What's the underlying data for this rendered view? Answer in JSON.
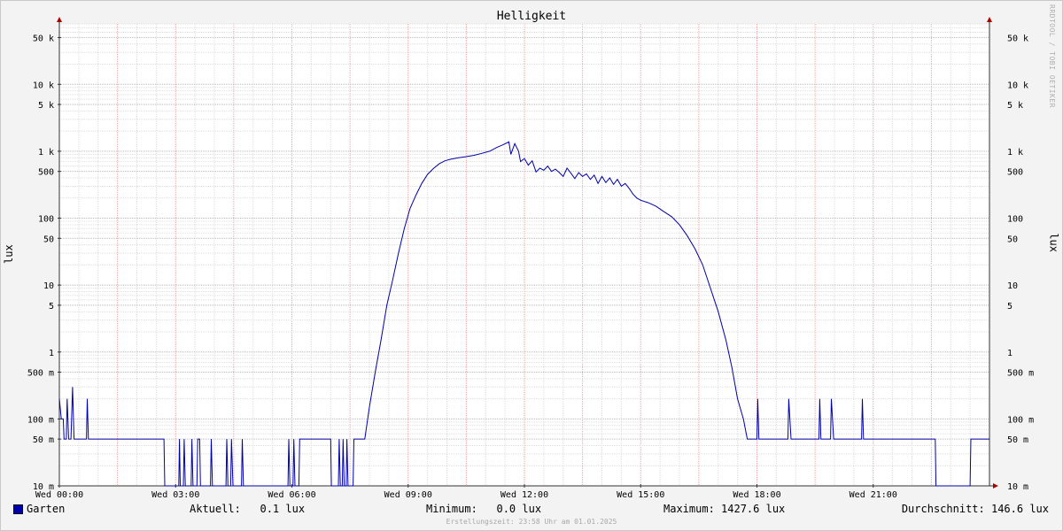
{
  "chart_data": {
    "type": "line",
    "title": "Helligkeit",
    "ylabel": "lux",
    "yscale": "log",
    "ylim": [
      0.01,
      80000
    ],
    "xlim": [
      0,
      24
    ],
    "grid": true,
    "watermark": "RRDTOOL / TOBI OETIKER",
    "yticks": [
      {
        "value": 0.01,
        "label": "10 m"
      },
      {
        "value": 0.05,
        "label": "50 m"
      },
      {
        "value": 0.1,
        "label": "100 m"
      },
      {
        "value": 0.5,
        "label": "500 m"
      },
      {
        "value": 1,
        "label": "1"
      },
      {
        "value": 5,
        "label": "5"
      },
      {
        "value": 10,
        "label": "10"
      },
      {
        "value": 50,
        "label": "50"
      },
      {
        "value": 100,
        "label": "100"
      },
      {
        "value": 500,
        "label": "500"
      },
      {
        "value": 1000,
        "label": "1 k"
      },
      {
        "value": 5000,
        "label": "5 k"
      },
      {
        "value": 10000,
        "label": "10 k"
      },
      {
        "value": 50000,
        "label": "50 k"
      }
    ],
    "xticks": [
      {
        "value": 0,
        "label": "Wed 00:00"
      },
      {
        "value": 3,
        "label": "Wed 03:00"
      },
      {
        "value": 6,
        "label": "Wed 06:00"
      },
      {
        "value": 9,
        "label": "Wed 09:00"
      },
      {
        "value": 12,
        "label": "Wed 12:00"
      },
      {
        "value": 15,
        "label": "Wed 15:00"
      },
      {
        "value": 18,
        "label": "Wed 18:00"
      },
      {
        "value": 21,
        "label": "Wed 21:00"
      }
    ],
    "series": [
      {
        "name": "Garten",
        "color": "#0000aa",
        "points": [
          [
            0.0,
            0.2
          ],
          [
            0.05,
            0.1
          ],
          [
            0.1,
            0.1
          ],
          [
            0.12,
            0.05
          ],
          [
            0.18,
            0.05
          ],
          [
            0.2,
            0.2
          ],
          [
            0.24,
            0.05
          ],
          [
            0.3,
            0.05
          ],
          [
            0.34,
            0.3
          ],
          [
            0.38,
            0.05
          ],
          [
            0.7,
            0.05
          ],
          [
            0.72,
            0.2
          ],
          [
            0.75,
            0.05
          ],
          [
            2.7,
            0.05
          ],
          [
            2.72,
            0.01
          ],
          [
            3.08,
            0.01
          ],
          [
            3.1,
            0.05
          ],
          [
            3.12,
            0.01
          ],
          [
            3.2,
            0.01
          ],
          [
            3.22,
            0.05
          ],
          [
            3.25,
            0.01
          ],
          [
            3.4,
            0.01
          ],
          [
            3.42,
            0.05
          ],
          [
            3.45,
            0.01
          ],
          [
            3.55,
            0.01
          ],
          [
            3.57,
            0.05
          ],
          [
            3.62,
            0.05
          ],
          [
            3.64,
            0.01
          ],
          [
            3.9,
            0.01
          ],
          [
            3.92,
            0.05
          ],
          [
            3.95,
            0.01
          ],
          [
            4.3,
            0.01
          ],
          [
            4.32,
            0.05
          ],
          [
            4.35,
            0.01
          ],
          [
            4.42,
            0.01
          ],
          [
            4.44,
            0.05
          ],
          [
            4.48,
            0.01
          ],
          [
            4.7,
            0.01
          ],
          [
            4.72,
            0.05
          ],
          [
            4.75,
            0.01
          ],
          [
            5.9,
            0.01
          ],
          [
            5.92,
            0.05
          ],
          [
            5.95,
            0.01
          ],
          [
            6.03,
            0.01
          ],
          [
            6.05,
            0.05
          ],
          [
            6.08,
            0.01
          ],
          [
            6.18,
            0.01
          ],
          [
            6.2,
            0.05
          ],
          [
            7.0,
            0.05
          ],
          [
            7.02,
            0.01
          ],
          [
            7.2,
            0.01
          ],
          [
            7.22,
            0.05
          ],
          [
            7.25,
            0.01
          ],
          [
            7.3,
            0.01
          ],
          [
            7.32,
            0.05
          ],
          [
            7.35,
            0.01
          ],
          [
            7.4,
            0.01
          ],
          [
            7.42,
            0.05
          ],
          [
            7.45,
            0.01
          ],
          [
            7.58,
            0.01
          ],
          [
            7.6,
            0.05
          ],
          [
            7.88,
            0.05
          ],
          [
            8.0,
            0.15
          ],
          [
            8.15,
            0.5
          ],
          [
            8.3,
            1.5
          ],
          [
            8.45,
            5
          ],
          [
            8.6,
            12
          ],
          [
            8.75,
            30
          ],
          [
            8.9,
            70
          ],
          [
            9.05,
            140
          ],
          [
            9.2,
            220
          ],
          [
            9.35,
            330
          ],
          [
            9.5,
            450
          ],
          [
            9.65,
            550
          ],
          [
            9.8,
            650
          ],
          [
            9.95,
            720
          ],
          [
            10.1,
            760
          ],
          [
            10.3,
            800
          ],
          [
            10.5,
            830
          ],
          [
            10.7,
            870
          ],
          [
            10.9,
            930
          ],
          [
            11.1,
            1000
          ],
          [
            11.3,
            1150
          ],
          [
            11.45,
            1250
          ],
          [
            11.6,
            1380
          ],
          [
            11.65,
            900
          ],
          [
            11.75,
            1300
          ],
          [
            11.85,
            1000
          ],
          [
            11.9,
            700
          ],
          [
            12.0,
            780
          ],
          [
            12.1,
            620
          ],
          [
            12.2,
            720
          ],
          [
            12.3,
            490
          ],
          [
            12.4,
            560
          ],
          [
            12.5,
            520
          ],
          [
            12.6,
            600
          ],
          [
            12.7,
            500
          ],
          [
            12.8,
            540
          ],
          [
            12.9,
            480
          ],
          [
            13.0,
            420
          ],
          [
            13.1,
            560
          ],
          [
            13.2,
            470
          ],
          [
            13.3,
            390
          ],
          [
            13.4,
            480
          ],
          [
            13.5,
            420
          ],
          [
            13.6,
            460
          ],
          [
            13.7,
            380
          ],
          [
            13.8,
            440
          ],
          [
            13.9,
            330
          ],
          [
            14.0,
            420
          ],
          [
            14.1,
            340
          ],
          [
            14.2,
            400
          ],
          [
            14.3,
            320
          ],
          [
            14.4,
            380
          ],
          [
            14.5,
            300
          ],
          [
            14.6,
            330
          ],
          [
            14.7,
            280
          ],
          [
            14.8,
            230
          ],
          [
            14.9,
            200
          ],
          [
            15.0,
            185
          ],
          [
            15.2,
            170
          ],
          [
            15.4,
            150
          ],
          [
            15.6,
            125
          ],
          [
            15.8,
            105
          ],
          [
            16.0,
            80
          ],
          [
            16.2,
            55
          ],
          [
            16.4,
            35
          ],
          [
            16.6,
            20
          ],
          [
            16.8,
            9
          ],
          [
            17.0,
            4
          ],
          [
            17.2,
            1.5
          ],
          [
            17.35,
            0.6
          ],
          [
            17.5,
            0.2
          ],
          [
            17.65,
            0.1
          ],
          [
            17.75,
            0.05
          ],
          [
            18.0,
            0.05
          ],
          [
            18.02,
            0.2
          ],
          [
            18.05,
            0.05
          ],
          [
            18.8,
            0.05
          ],
          [
            18.82,
            0.2
          ],
          [
            18.88,
            0.05
          ],
          [
            19.6,
            0.05
          ],
          [
            19.62,
            0.2
          ],
          [
            19.65,
            0.05
          ],
          [
            19.9,
            0.05
          ],
          [
            19.92,
            0.2
          ],
          [
            19.98,
            0.05
          ],
          [
            20.7,
            0.05
          ],
          [
            20.72,
            0.2
          ],
          [
            20.75,
            0.05
          ],
          [
            22.6,
            0.05
          ],
          [
            22.62,
            0.01
          ],
          [
            23.5,
            0.01
          ],
          [
            23.52,
            0.05
          ],
          [
            24.0,
            0.05
          ]
        ]
      }
    ]
  },
  "legend": {
    "series_name": "Garten",
    "current": "Aktuell:   0.1 lux",
    "minimum": "Minimum:   0.0 lux",
    "maximum": "Maximum: 1427.6 lux",
    "average": "Durchschnitt: 146.6 lux"
  },
  "footer": "Erstellungszeit: 23:58 Uhr am 01.01.2025"
}
